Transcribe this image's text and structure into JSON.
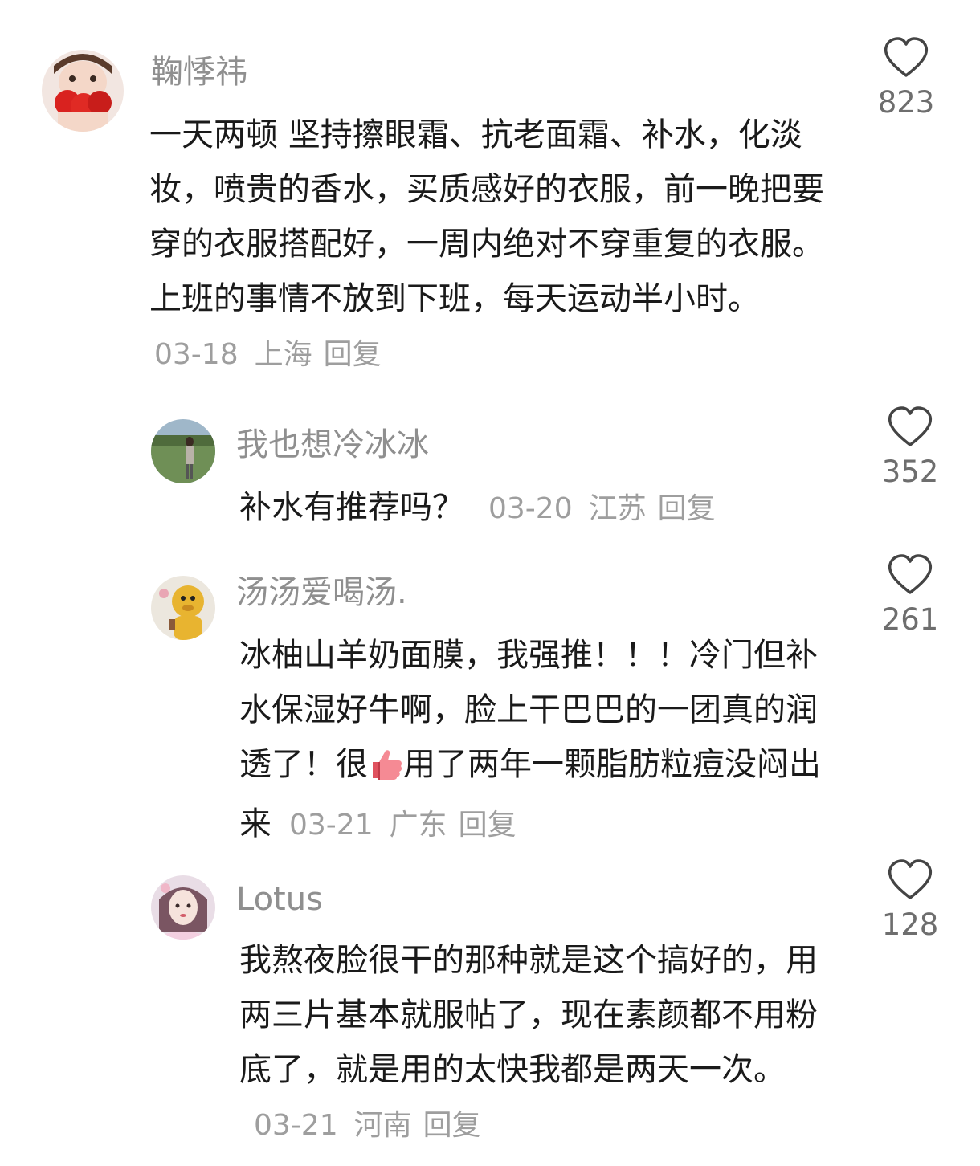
{
  "comments": [
    {
      "username": "鞠悸祎",
      "text": "一天两顿 坚持擦眼霜、抗老面霜、补水，化淡妆，喷贵的香水，买质感好的衣服，前一晚把要穿的衣服搭配好，一周内绝对不穿重复的衣服。上班的事情不放到下班，每天运动半小时。",
      "date": "03-18",
      "location": "上海",
      "reply_label": "回复",
      "likes": "823",
      "avatar_colors": [
        "#f2e6e1",
        "#d9221f"
      ]
    },
    {
      "username": "我也想冷冰冰",
      "text": "补水有推荐吗？",
      "date": "03-20",
      "location": "江苏",
      "reply_label": "回复",
      "likes": "352",
      "avatar_colors": [
        "#6f8f56",
        "#b9b2a8"
      ]
    },
    {
      "username": "汤汤爱喝汤.",
      "text_before_emoji": "冰柚山羊奶面膜，我强推！！！冷门但补水保湿好牛啊，脸上干巴巴的一团真的润透了！很",
      "emoji": "thumbs-up",
      "text_after_emoji": "用了两年一颗脂肪粒痘没闷出来",
      "date": "03-21",
      "location": "广东",
      "reply_label": "回复",
      "likes": "261",
      "avatar_colors": [
        "#ece7de",
        "#e8b430"
      ]
    },
    {
      "username": "Lotus",
      "text": "我熬夜脸很干的那种就是这个搞好的，用两三片基本就服帖了，现在素颜都不用粉底了，就是用的太快我都是两天一次。",
      "date": "03-21",
      "location": "河南",
      "reply_label": "回复",
      "likes": "128",
      "avatar_colors": [
        "#e9dde6",
        "#7a5562"
      ]
    }
  ],
  "icons": {
    "like": "heart-outline-icon",
    "emoji": "thumbs-up-icon"
  },
  "colors": {
    "username": "#8f8f8f",
    "meta": "#9e9e9e",
    "text": "#1a1a1a",
    "like_count": "#6e6e6e"
  }
}
